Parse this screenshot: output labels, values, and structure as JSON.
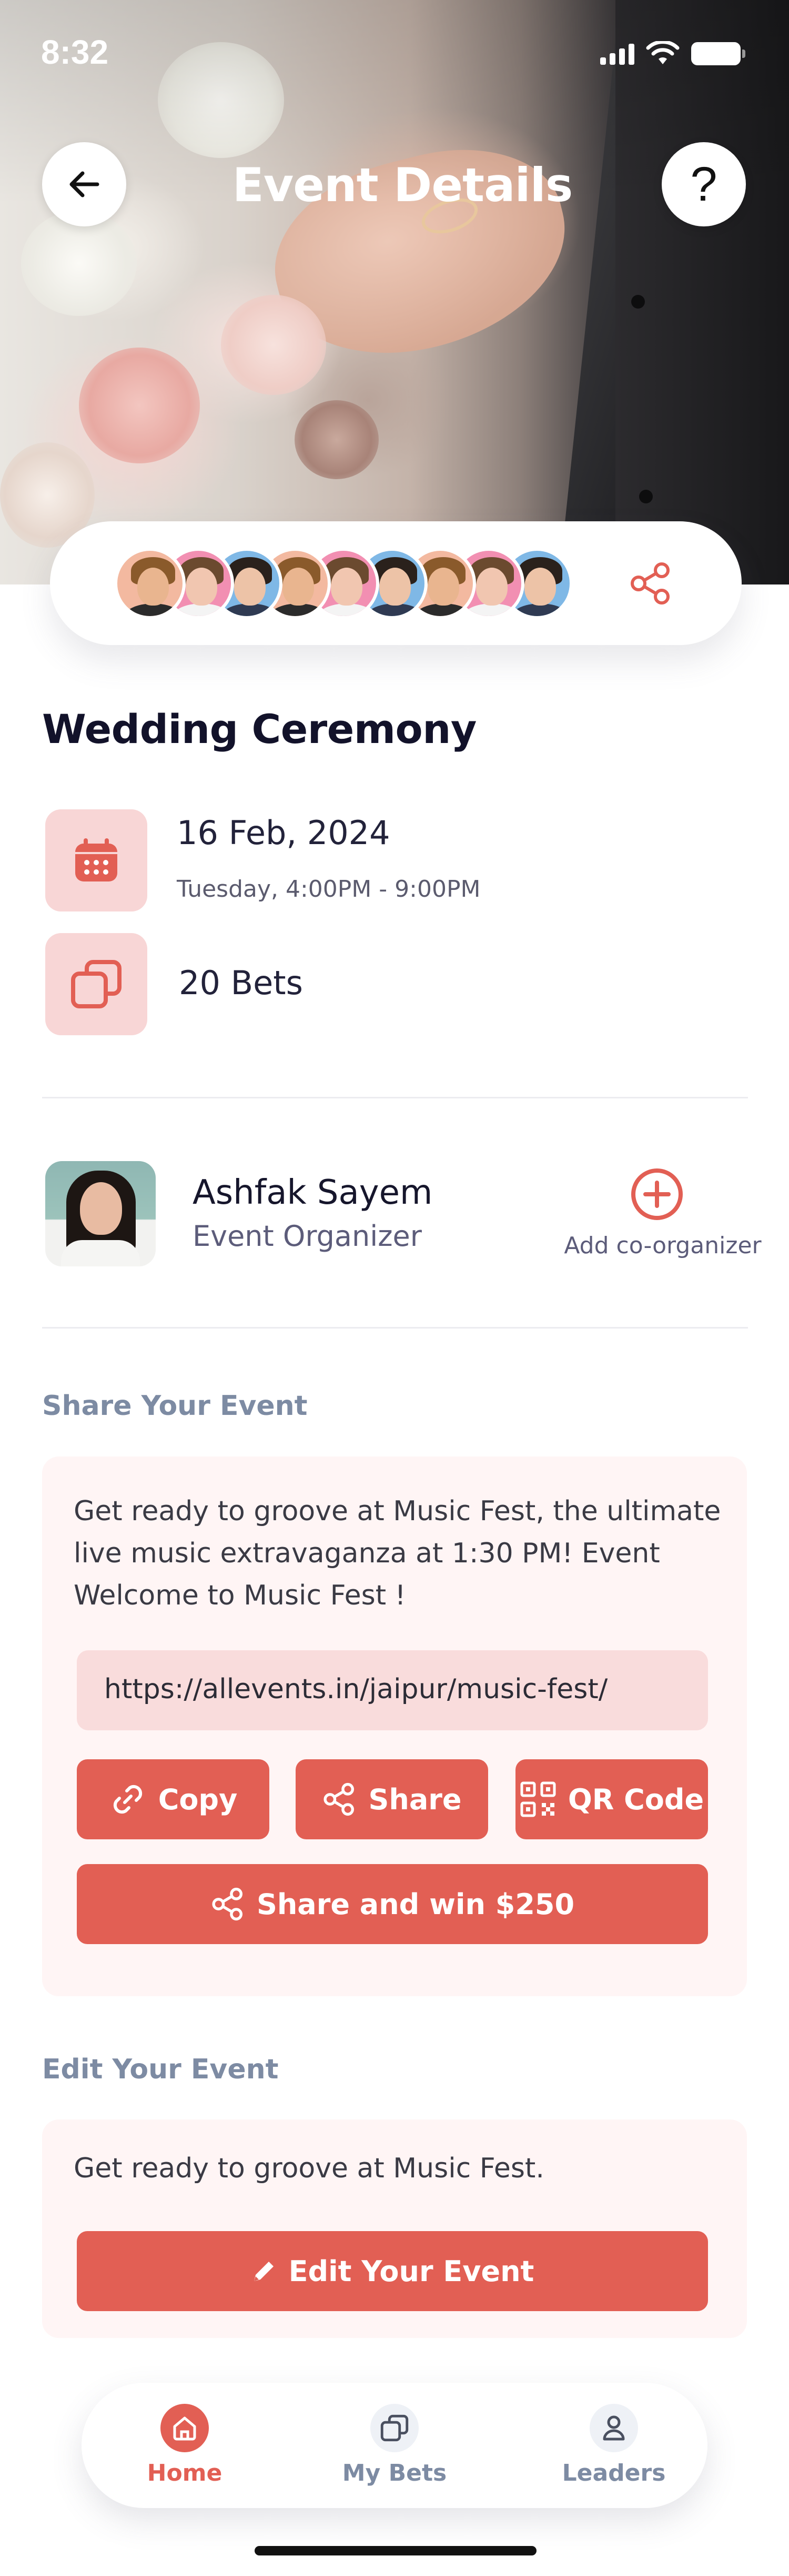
{
  "status_bar": {
    "time": "8:32"
  },
  "header": {
    "title": "Event Details",
    "help_label": "?"
  },
  "attendees": {
    "avatars": [
      {
        "skin": "#e9b58f",
        "hair": "#8a5a2b",
        "shirt": "#2b2b2b",
        "bg": "#f3b9a0"
      },
      {
        "skin": "#f1c6b0",
        "hair": "#6b4a2f",
        "shirt": "#f4f4f4",
        "bg": "#f28fb2"
      },
      {
        "skin": "#edc3a7",
        "hair": "#2a211c",
        "shirt": "#2f3a52",
        "bg": "#7fb8e6"
      },
      {
        "skin": "#e9b58f",
        "hair": "#8a5a2b",
        "shirt": "#2b2b2b",
        "bg": "#f3b9a0"
      },
      {
        "skin": "#f1c6b0",
        "hair": "#6b4a2f",
        "shirt": "#f4f4f4",
        "bg": "#f28fb2"
      },
      {
        "skin": "#edc3a7",
        "hair": "#2a211c",
        "shirt": "#2f3a52",
        "bg": "#7fb8e6"
      },
      {
        "skin": "#e9b58f",
        "hair": "#8a5a2b",
        "shirt": "#2b2b2b",
        "bg": "#f3b9a0"
      },
      {
        "skin": "#f1c6b0",
        "hair": "#6b4a2f",
        "shirt": "#f4f4f4",
        "bg": "#f28fb2"
      },
      {
        "skin": "#edc3a7",
        "hair": "#2a211c",
        "shirt": "#2f3a52",
        "bg": "#7fb8e6"
      }
    ]
  },
  "event": {
    "title": "Wedding Ceremony",
    "date": "16 Feb, 2024",
    "time": "Tuesday, 4:00PM - 9:00PM",
    "bets": "20 Bets"
  },
  "organizer": {
    "name": "Ashfak Sayem",
    "role": "Event Organizer",
    "add_label": "Add co-organizer"
  },
  "share": {
    "section_label": "Share Your Event",
    "description": "Get ready to groove at Music Fest, the ultimate live music extravaganza  at 1:30 PM! Event Welcome to Music Fest !",
    "url": "https://allevents.in/jaipur/music-fest/",
    "copy_label": "Copy",
    "share_label": "Share",
    "qr_label": "QR Code",
    "win_label": "Share and win $250"
  },
  "edit": {
    "section_label": "Edit Your Event",
    "description": "Get ready to groove at Music Fest.",
    "button_label": "Edit Your Event"
  },
  "nav": {
    "items": [
      {
        "label": "Home",
        "active": true
      },
      {
        "label": "My Bets",
        "active": false
      },
      {
        "label": "Leaders",
        "active": false
      }
    ]
  },
  "colors": {
    "accent": "#e25f54",
    "icon_tile": "#f8d6d6",
    "panel_bg": "#fff5f5",
    "section_label": "#7d8ba3",
    "nav_inactive": "#7d8ba3"
  },
  "icons": {
    "back": "arrow-left-icon",
    "help": "question-icon",
    "share": "share-icon",
    "calendar": "calendar-icon",
    "bets": "cards-icon",
    "add": "plus-circle-icon",
    "copy": "link-icon",
    "qr": "qr-code-icon",
    "edit": "pencil-icon",
    "home": "home-icon",
    "leaders": "user-icon"
  }
}
